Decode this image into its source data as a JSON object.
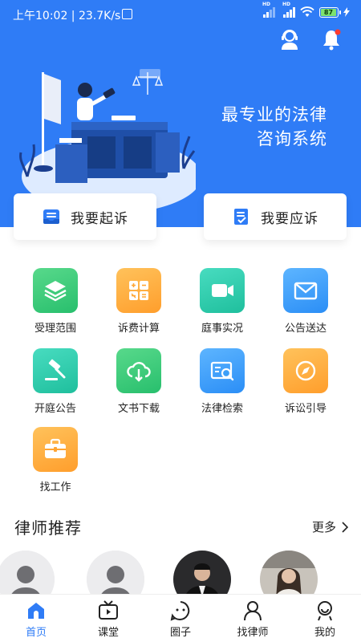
{
  "status": {
    "time": "上午10:02 | 23.7K/s",
    "battery": "87",
    "network_badge": "HD"
  },
  "header": {
    "slogan_line1": "最专业的法律",
    "slogan_line2": "咨询系统"
  },
  "actions": {
    "sue_label": "我要起诉",
    "respond_label": "我要应诉"
  },
  "services": [
    {
      "label": "受理范围",
      "icon": "layers-icon",
      "color": "#2fc878"
    },
    {
      "label": "诉费计算",
      "icon": "calculator-icon",
      "color": "#ffac3d"
    },
    {
      "label": "庭事实况",
      "icon": "video-camera-icon",
      "color": "#27c9a6"
    },
    {
      "label": "公告送达",
      "icon": "mail-icon",
      "color": "#3d9ff8"
    },
    {
      "label": "开庭公告",
      "icon": "gavel-icon",
      "color": "#27c9a6"
    },
    {
      "label": "文书下载",
      "icon": "cloud-download-icon",
      "color": "#2fc878"
    },
    {
      "label": "法律检索",
      "icon": "search-card-icon",
      "color": "#3d9ff8"
    },
    {
      "label": "诉讼引导",
      "icon": "compass-icon",
      "color": "#ffac3d"
    },
    {
      "label": "找工作",
      "icon": "briefcase-icon",
      "color": "#ffac3d"
    }
  ],
  "lawyers": {
    "title": "律师推荐",
    "more_label": "更多"
  },
  "tabbar": [
    {
      "label": "首页",
      "icon": "home-icon",
      "active": true
    },
    {
      "label": "课堂",
      "icon": "tv-icon",
      "active": false
    },
    {
      "label": "圈子",
      "icon": "smile-icon",
      "active": false
    },
    {
      "label": "找律师",
      "icon": "person-icon",
      "active": false
    },
    {
      "label": "我的",
      "icon": "profile-icon",
      "active": false
    }
  ],
  "colors": {
    "primary": "#2f7cf6",
    "text": "#222222"
  }
}
